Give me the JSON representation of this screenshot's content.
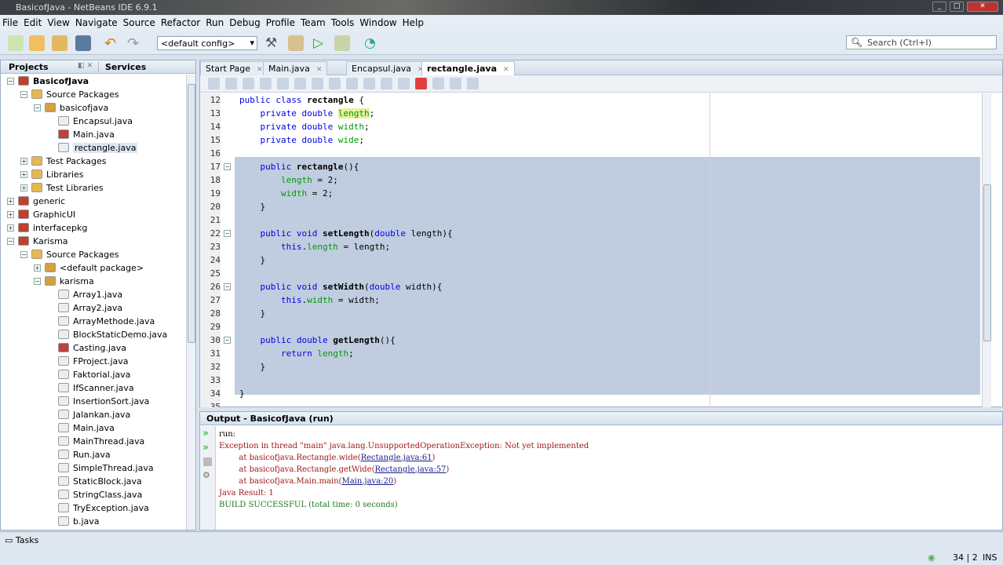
{
  "window": {
    "title": "BasicofJava - NetBeans IDE 6.9.1"
  },
  "menu": [
    "File",
    "Edit",
    "View",
    "Navigate",
    "Source",
    "Refactor",
    "Run",
    "Debug",
    "Profile",
    "Team",
    "Tools",
    "Window",
    "Help"
  ],
  "toolbar": {
    "config": "<default config>",
    "search_placeholder": "Search (Ctrl+I)"
  },
  "projects": {
    "tab1": "Projects",
    "tab2": "Services",
    "tree": [
      {
        "label": "BasicofJava",
        "level": 0,
        "bold": true,
        "kind": "project"
      },
      {
        "label": "Source Packages",
        "level": 1,
        "kind": "folder"
      },
      {
        "label": "basicofjava",
        "level": 2,
        "kind": "package"
      },
      {
        "label": "Encapsul.java",
        "level": 3,
        "kind": "file"
      },
      {
        "label": "Main.java",
        "level": 3,
        "kind": "file-err"
      },
      {
        "label": "rectangle.java",
        "level": 3,
        "kind": "file",
        "selected": true
      },
      {
        "label": "Test Packages",
        "level": 1,
        "kind": "folder"
      },
      {
        "label": "Libraries",
        "level": 1,
        "kind": "folder"
      },
      {
        "label": "Test Libraries",
        "level": 1,
        "kind": "folder"
      },
      {
        "label": "generic",
        "level": 0,
        "kind": "project"
      },
      {
        "label": "GraphicUI",
        "level": 0,
        "kind": "project"
      },
      {
        "label": "interfacepkg",
        "level": 0,
        "kind": "project"
      },
      {
        "label": "Karisma",
        "level": 0,
        "kind": "project"
      },
      {
        "label": "Source Packages",
        "level": 1,
        "kind": "folder"
      },
      {
        "label": "<default package>",
        "level": 2,
        "kind": "package"
      },
      {
        "label": "karisma",
        "level": 2,
        "kind": "package"
      },
      {
        "label": "Array1.java",
        "level": 3,
        "kind": "file"
      },
      {
        "label": "Array2.java",
        "level": 3,
        "kind": "file"
      },
      {
        "label": "ArrayMethode.java",
        "level": 3,
        "kind": "file"
      },
      {
        "label": "BlockStaticDemo.java",
        "level": 3,
        "kind": "file"
      },
      {
        "label": "Casting.java",
        "level": 3,
        "kind": "file-err"
      },
      {
        "label": "FProject.java",
        "level": 3,
        "kind": "file"
      },
      {
        "label": "Faktorial.java",
        "level": 3,
        "kind": "file"
      },
      {
        "label": "IfScanner.java",
        "level": 3,
        "kind": "file"
      },
      {
        "label": "InsertionSort.java",
        "level": 3,
        "kind": "file"
      },
      {
        "label": "Jalankan.java",
        "level": 3,
        "kind": "file"
      },
      {
        "label": "Main.java",
        "level": 3,
        "kind": "file"
      },
      {
        "label": "MainThread.java",
        "level": 3,
        "kind": "file"
      },
      {
        "label": "Run.java",
        "level": 3,
        "kind": "file"
      },
      {
        "label": "SimpleThread.java",
        "level": 3,
        "kind": "file"
      },
      {
        "label": "StaticBlock.java",
        "level": 3,
        "kind": "file"
      },
      {
        "label": "StringClass.java",
        "level": 3,
        "kind": "file"
      },
      {
        "label": "TryException.java",
        "level": 3,
        "kind": "file"
      },
      {
        "label": "b.java",
        "level": 3,
        "kind": "file"
      }
    ]
  },
  "editor": {
    "tabs": [
      {
        "label": "Start Page"
      },
      {
        "label": "Main.java"
      },
      {
        "label": "Encapsul.java"
      },
      {
        "label": "rectangle.java",
        "active": true
      }
    ],
    "lines": [
      {
        "n": "12",
        "html": "<span class='kw'>public class</span> <span class='b'>rectangle</span> {"
      },
      {
        "n": "13",
        "html": "    <span class='kw'>private double</span> <span class='fd' style='background:#e8f0a0'>length</span>;"
      },
      {
        "n": "14",
        "html": "    <span class='kw'>private double</span> <span class='fd'>width</span>;"
      },
      {
        "n": "15",
        "html": "    <span class='kw'>private double</span> <span class='fd'>wide</span>;"
      },
      {
        "n": "16",
        "html": ""
      },
      {
        "n": "17",
        "html": "    <span class='kw'>public</span> <span class='b'>rectangle</span>(){"
      },
      {
        "n": "18",
        "html": "        <span class='fd'>length</span> = 2;"
      },
      {
        "n": "19",
        "html": "        <span class='fd'>width</span> = 2;"
      },
      {
        "n": "20",
        "html": "    }"
      },
      {
        "n": "21",
        "html": ""
      },
      {
        "n": "22",
        "html": "    <span class='kw'>public void</span> <span class='b'>setLength</span>(<span class='kw'>double</span> length){"
      },
      {
        "n": "23",
        "html": "        <span class='kw'>this</span>.<span class='fd'>length</span> = length;"
      },
      {
        "n": "24",
        "html": "    }"
      },
      {
        "n": "25",
        "html": ""
      },
      {
        "n": "26",
        "html": "    <span class='kw'>public void</span> <span class='b'>setWidth</span>(<span class='kw'>double</span> width){"
      },
      {
        "n": "27",
        "html": "        <span class='kw'>this</span>.<span class='fd'>width</span> = width;"
      },
      {
        "n": "28",
        "html": "    }"
      },
      {
        "n": "29",
        "html": ""
      },
      {
        "n": "30",
        "html": "    <span class='kw'>public double</span> <span class='b'>getLength</span>(){"
      },
      {
        "n": "31",
        "html": "        <span class='kw'>return</span> <span class='fd'>length</span>;"
      },
      {
        "n": "32",
        "html": "    }"
      },
      {
        "n": "33",
        "html": ""
      },
      {
        "n": "34",
        "html": "}"
      },
      {
        "n": "35",
        "html": ""
      }
    ]
  },
  "output": {
    "title": "Output - BasicofJava (run)",
    "lines": [
      {
        "cls": "",
        "parts": [
          {
            "t": "run:"
          }
        ]
      },
      {
        "cls": "err",
        "parts": [
          {
            "t": "Exception in thread \"main\" java.lang.UnsupportedOperationException: Not yet implemented"
          }
        ]
      },
      {
        "cls": "err",
        "parts": [
          {
            "t": "        at basicofjava.Rectangle.wide("
          },
          {
            "t": "Rectangle.java:61",
            "link": true
          },
          {
            "t": ")"
          }
        ]
      },
      {
        "cls": "err",
        "parts": [
          {
            "t": "        at basicofjava.Rectangle.getWide("
          },
          {
            "t": "Rectangle.java:57",
            "link": true
          },
          {
            "t": ")"
          }
        ]
      },
      {
        "cls": "err",
        "parts": [
          {
            "t": "        at basicofjava.Main.main("
          },
          {
            "t": "Main.java:20",
            "link": true
          },
          {
            "t": ")"
          }
        ]
      },
      {
        "cls": "err",
        "parts": [
          {
            "t": "Java Result: 1"
          }
        ]
      },
      {
        "cls": "ok",
        "parts": [
          {
            "t": "BUILD SUCCESSFUL (total time: 0 seconds)"
          }
        ]
      }
    ]
  },
  "status": {
    "tasks": "Tasks",
    "position": "34 | 2",
    "mode": "INS"
  }
}
